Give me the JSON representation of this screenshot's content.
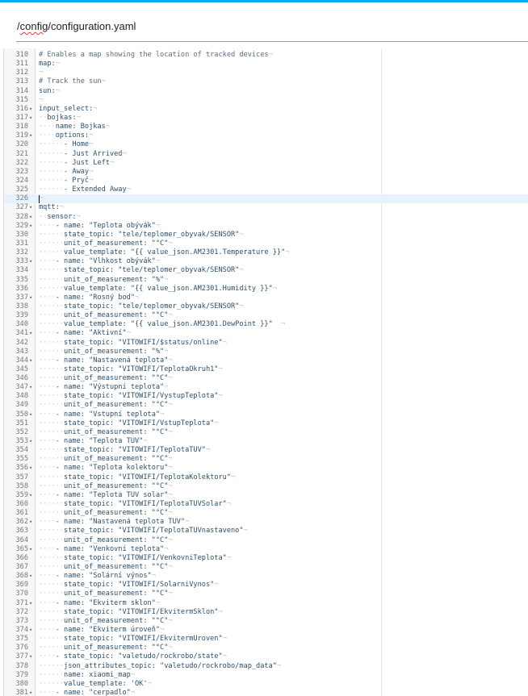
{
  "file_path": {
    "prefix": "/",
    "underlined": "config",
    "suffix": "/configuration.yaml"
  },
  "active_line": 326,
  "lines": [
    {
      "n": "310",
      "fold": false,
      "indent": 0,
      "text": "# Enables a map showing the location of tracked devices",
      "comment": true
    },
    {
      "n": "311",
      "fold": false,
      "indent": 0,
      "text": "map:"
    },
    {
      "n": "312",
      "fold": false,
      "indent": 0,
      "text": ""
    },
    {
      "n": "313",
      "fold": false,
      "indent": 0,
      "text": "# Track the sun",
      "comment": true
    },
    {
      "n": "314",
      "fold": false,
      "indent": 0,
      "text": "sun:"
    },
    {
      "n": "315",
      "fold": false,
      "indent": 0,
      "text": ""
    },
    {
      "n": "316",
      "fold": true,
      "indent": 0,
      "text": "input_select:"
    },
    {
      "n": "317",
      "fold": true,
      "indent": 2,
      "text": "bojkas:"
    },
    {
      "n": "318",
      "fold": false,
      "indent": 4,
      "text": "name: Bojkas"
    },
    {
      "n": "319",
      "fold": true,
      "indent": 4,
      "text": "options:"
    },
    {
      "n": "320",
      "fold": false,
      "indent": 6,
      "text": "- Home"
    },
    {
      "n": "321",
      "fold": false,
      "indent": 6,
      "text": "- Just Arrived"
    },
    {
      "n": "322",
      "fold": false,
      "indent": 6,
      "text": "- Just Left"
    },
    {
      "n": "323",
      "fold": false,
      "indent": 6,
      "text": "- Away"
    },
    {
      "n": "324",
      "fold": false,
      "indent": 6,
      "text": "- Pryč"
    },
    {
      "n": "325",
      "fold": false,
      "indent": 6,
      "text": "- Extended Away"
    },
    {
      "n": "326",
      "fold": false,
      "indent": 0,
      "text": ""
    },
    {
      "n": "327",
      "fold": true,
      "indent": 0,
      "text": "mqtt:"
    },
    {
      "n": "328",
      "fold": true,
      "indent": 2,
      "text": "sensor:"
    },
    {
      "n": "329",
      "fold": true,
      "indent": 4,
      "text": "- name: \"Teplota obývák\""
    },
    {
      "n": "330",
      "fold": false,
      "indent": 6,
      "text": "state_topic: \"tele/teplomer_obyvak/SENSOR\""
    },
    {
      "n": "331",
      "fold": false,
      "indent": 6,
      "text": "unit_of_measurement: \"°C\""
    },
    {
      "n": "332",
      "fold": false,
      "indent": 6,
      "text": "value_template: \"{{ value_json.AM2301.Temperature }}\""
    },
    {
      "n": "333",
      "fold": true,
      "indent": 4,
      "text": "- name: \"Vlhkost obývák\""
    },
    {
      "n": "334",
      "fold": false,
      "indent": 6,
      "text": "state_topic: \"tele/teplomer_obyvak/SENSOR\""
    },
    {
      "n": "335",
      "fold": false,
      "indent": 6,
      "text": "unit_of_measurement: \"%\""
    },
    {
      "n": "336",
      "fold": false,
      "indent": 6,
      "text": "value_template: \"{{ value_json.AM2301.Humidity }}\""
    },
    {
      "n": "337",
      "fold": true,
      "indent": 4,
      "text": "- name: \"Rosný bod\""
    },
    {
      "n": "338",
      "fold": false,
      "indent": 6,
      "text": "state_topic: \"tele/teplomer_obyvak/SENSOR\""
    },
    {
      "n": "339",
      "fold": false,
      "indent": 6,
      "text": "unit_of_measurement: \"°C\""
    },
    {
      "n": "340",
      "fold": false,
      "indent": 6,
      "text": "value_template: \"{{ value_json.AM2301.DewPoint }}\"  "
    },
    {
      "n": "341",
      "fold": true,
      "indent": 4,
      "text": "- name: \"Aktivní\""
    },
    {
      "n": "342",
      "fold": false,
      "indent": 6,
      "text": "state_topic: \"VITOWIFI/$status/online\""
    },
    {
      "n": "343",
      "fold": false,
      "indent": 6,
      "text": "unit_of_measurement: \"%\""
    },
    {
      "n": "344",
      "fold": true,
      "indent": 4,
      "text": "- name: \"Nastavená teplota\""
    },
    {
      "n": "345",
      "fold": false,
      "indent": 6,
      "text": "state_topic: \"VITOWIFI/TeplotaOkruh1\""
    },
    {
      "n": "346",
      "fold": false,
      "indent": 6,
      "text": "unit_of_measurement: \"°C\""
    },
    {
      "n": "347",
      "fold": true,
      "indent": 4,
      "text": "- name: \"Výstupní teplota\""
    },
    {
      "n": "348",
      "fold": false,
      "indent": 6,
      "text": "state_topic: \"VITOWIFI/VystupTeplota\""
    },
    {
      "n": "349",
      "fold": false,
      "indent": 6,
      "text": "unit_of_measurement: \"°C\""
    },
    {
      "n": "350",
      "fold": true,
      "indent": 4,
      "text": "- name: \"Vstupní teplota\""
    },
    {
      "n": "351",
      "fold": false,
      "indent": 6,
      "text": "state_topic: \"VITOWIFI/VstupTeplota\""
    },
    {
      "n": "352",
      "fold": false,
      "indent": 6,
      "text": "unit_of_measurement: \"°C\""
    },
    {
      "n": "353",
      "fold": true,
      "indent": 4,
      "text": "- name: \"Teplota TUV\""
    },
    {
      "n": "354",
      "fold": false,
      "indent": 6,
      "text": "state_topic: \"VITOWIFI/TeplotaTUV\""
    },
    {
      "n": "355",
      "fold": false,
      "indent": 6,
      "text": "unit_of_measurement: \"°C\""
    },
    {
      "n": "356",
      "fold": true,
      "indent": 4,
      "text": "- name: \"Teplota kolektoru\""
    },
    {
      "n": "357",
      "fold": false,
      "indent": 6,
      "text": "state_topic: \"VITOWIFI/TeplotaKolektoru\""
    },
    {
      "n": "358",
      "fold": false,
      "indent": 6,
      "text": "unit_of_measurement: \"°C\""
    },
    {
      "n": "359",
      "fold": true,
      "indent": 4,
      "text": "- name: \"Teplota TUV solar\""
    },
    {
      "n": "360",
      "fold": false,
      "indent": 6,
      "text": "state_topic: \"VITOWIFI/TeplotaTUVSolar\""
    },
    {
      "n": "361",
      "fold": false,
      "indent": 6,
      "text": "unit_of_measurement: \"°C\""
    },
    {
      "n": "362",
      "fold": true,
      "indent": 4,
      "text": "- name: \"Nastavená teplota TUV\""
    },
    {
      "n": "363",
      "fold": false,
      "indent": 6,
      "text": "state_topic: \"VITOWIFI/TeplotaTUVnastaveno\""
    },
    {
      "n": "364",
      "fold": false,
      "indent": 6,
      "text": "unit_of_measurement: \"°C\""
    },
    {
      "n": "365",
      "fold": true,
      "indent": 4,
      "text": "- name: \"Venkovní teplota\""
    },
    {
      "n": "366",
      "fold": false,
      "indent": 6,
      "text": "state_topic: \"VITOWIFI/VenkovniTeplota\""
    },
    {
      "n": "367",
      "fold": false,
      "indent": 6,
      "text": "unit_of_measurement: \"°C\""
    },
    {
      "n": "368",
      "fold": true,
      "indent": 4,
      "text": "- name: \"Solární výnos\""
    },
    {
      "n": "369",
      "fold": false,
      "indent": 6,
      "text": "state_topic: \"VITOWIFI/SolarniVynos\""
    },
    {
      "n": "370",
      "fold": false,
      "indent": 6,
      "text": "unit_of_measurement: \"°C\""
    },
    {
      "n": "371",
      "fold": true,
      "indent": 4,
      "text": "- name: \"Ekviterm sklon\""
    },
    {
      "n": "372",
      "fold": false,
      "indent": 6,
      "text": "state_topic: \"VITOWIFI/EkvitermSklon\""
    },
    {
      "n": "373",
      "fold": false,
      "indent": 6,
      "text": "unit_of_measurement: \"°C\""
    },
    {
      "n": "374",
      "fold": true,
      "indent": 4,
      "text": "- name: \"Ekviterm úroveň\""
    },
    {
      "n": "375",
      "fold": false,
      "indent": 6,
      "text": "state_topic: \"VITOWIFI/EkvitermUroven\""
    },
    {
      "n": "376",
      "fold": false,
      "indent": 6,
      "text": "unit_of_measurement: \"°C\""
    },
    {
      "n": "377",
      "fold": true,
      "indent": 4,
      "text": "- state_topic: \"valetudo/rockrobo/state\""
    },
    {
      "n": "378",
      "fold": false,
      "indent": 6,
      "text": "json_attributes_topic: \"valetudo/rockrobo/map_data\""
    },
    {
      "n": "379",
      "fold": false,
      "indent": 6,
      "text": "name: xiaomi_map"
    },
    {
      "n": "380",
      "fold": false,
      "indent": 6,
      "text": "value_template: 'OK'"
    },
    {
      "n": "381",
      "fold": true,
      "indent": 4,
      "text": "- name: \"cerpadlo\""
    }
  ]
}
